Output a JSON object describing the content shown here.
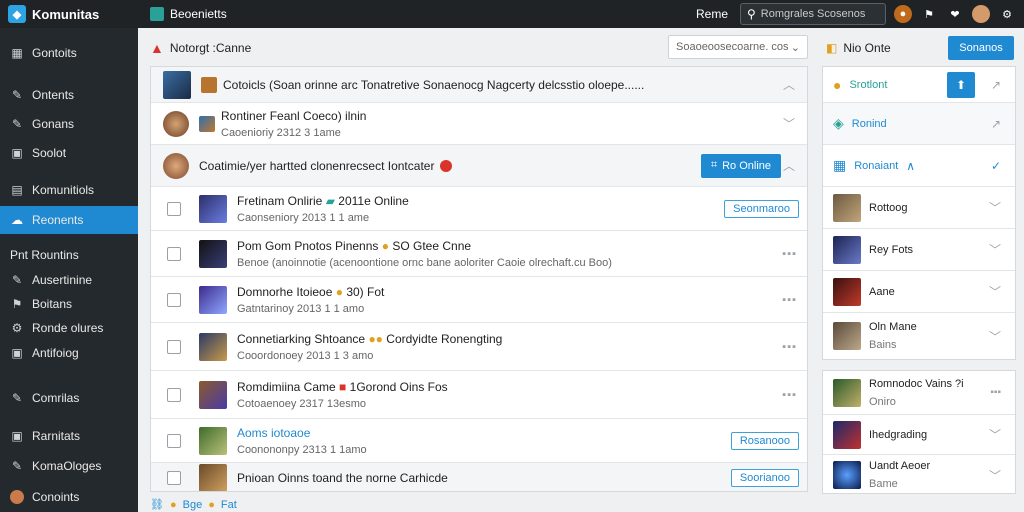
{
  "topbar": {
    "app_name": "Komunitas",
    "breadcrumb": "Beoenietts",
    "link": "Reme",
    "search_placeholder": "Romgrales Scosenos"
  },
  "sidebar": {
    "items": [
      {
        "label": "Gontoits",
        "icon": "grid-icon"
      },
      {
        "label": "Ontents",
        "icon": "pin-icon"
      },
      {
        "label": "Gonans",
        "icon": "pin-icon"
      },
      {
        "label": "Soolot",
        "icon": "image-icon"
      },
      {
        "label": "Komunitiols",
        "icon": "list-icon"
      },
      {
        "label": "Reonents",
        "icon": "cloud-icon",
        "active": true
      },
      {
        "label": "Pnt Rountins",
        "icon": "none"
      },
      {
        "label": "Ausertinine",
        "icon": "pin-icon"
      },
      {
        "label": "Boitans",
        "icon": "tag-icon"
      },
      {
        "label": "Ronde olures",
        "icon": "gear-icon"
      },
      {
        "label": "Antifoiog",
        "icon": "image-icon"
      },
      {
        "label": "Comrilas",
        "icon": "pin-icon"
      },
      {
        "label": "Rarnitats",
        "icon": "image-icon"
      },
      {
        "label": "KomaOloges",
        "icon": "pin-icon"
      },
      {
        "label": "Conoints",
        "icon": "avatar-icon"
      }
    ]
  },
  "main": {
    "title": "Notorgt :Canne",
    "dropdown_value": "Soaoeoosecoarne. cos",
    "rows": [
      {
        "kind": "header",
        "title": "Cotoicls (Soan orinne arc Tonatretive Sonaenocg Nagcerty delcsstio oloepe......"
      },
      {
        "kind": "user",
        "title": "Rontiner Feanl Coeco) ilnin",
        "sub": "Caoenioriy 2312 3 1ame"
      },
      {
        "kind": "post",
        "title": "Coatimie/yer hartted clonenrecsect Iontcater",
        "button": "Ro Online"
      },
      {
        "kind": "item",
        "title": "Fretinam Onlirie",
        "badge": "2011e Online",
        "sub": "Caonseniory 2013 1 1 ame",
        "action": "Seonmaroo"
      },
      {
        "kind": "item",
        "title": "Pom Gom Pnotos Pinenns",
        "badge": "SO Gtee Cnne",
        "sub": "Benoe (anoinnotie (acenoontione ornc bane aoloriter Caoie olrechaft.cu  Boo)",
        "action": "dots"
      },
      {
        "kind": "item",
        "title": "Domnorhe Itoieoe",
        "badge": "30) Fot",
        "sub": "Gatntarinoy 2013 1 1 amo",
        "action": "dots"
      },
      {
        "kind": "item",
        "title": "Connetiarking Shtoance",
        "badge": "Cordyidte Ronengting",
        "sub": "Cooordonoey 2013 1 3 amo",
        "action": "dots"
      },
      {
        "kind": "item",
        "title": "Romdimiina Came",
        "badge": "1Gorond Oins Fos",
        "sub": "Cotoaenoey 2317 13esmo",
        "action": "dots"
      },
      {
        "kind": "item",
        "title": "Aoms iotoaoe",
        "sub": "Coonononpy 2313 1 1amo",
        "action": "Rosanooo"
      },
      {
        "kind": "item",
        "title": "Pnioan Oinns toand the norne Carhicde",
        "action": "Soorianoo"
      }
    ],
    "footer": [
      "Bge",
      "Fat"
    ]
  },
  "right": {
    "header_label": "Nio Onte",
    "header_button": "Sonanos",
    "top_items": [
      {
        "label": "Srotlont"
      },
      {
        "label": "Ronind"
      },
      {
        "label": "Ronaiant"
      }
    ],
    "people": [
      {
        "label": "Rottoog",
        "sub": ""
      },
      {
        "label": "Rey Fots",
        "sub": ""
      },
      {
        "label": "Aane",
        "sub": ""
      },
      {
        "label": "Oln Mane",
        "sub": "Bains"
      }
    ],
    "more": [
      {
        "label": "Romnodoc Vains ?i",
        "sub": "Oniro"
      },
      {
        "label": "Ihedgrading",
        "sub": ""
      },
      {
        "label": "Uandt Aeoer",
        "sub": "Bame"
      }
    ]
  },
  "colors": {
    "accent": "#1f8ad2",
    "sidebar_bg": "#24292d",
    "topbar_bg": "#1f2326"
  }
}
